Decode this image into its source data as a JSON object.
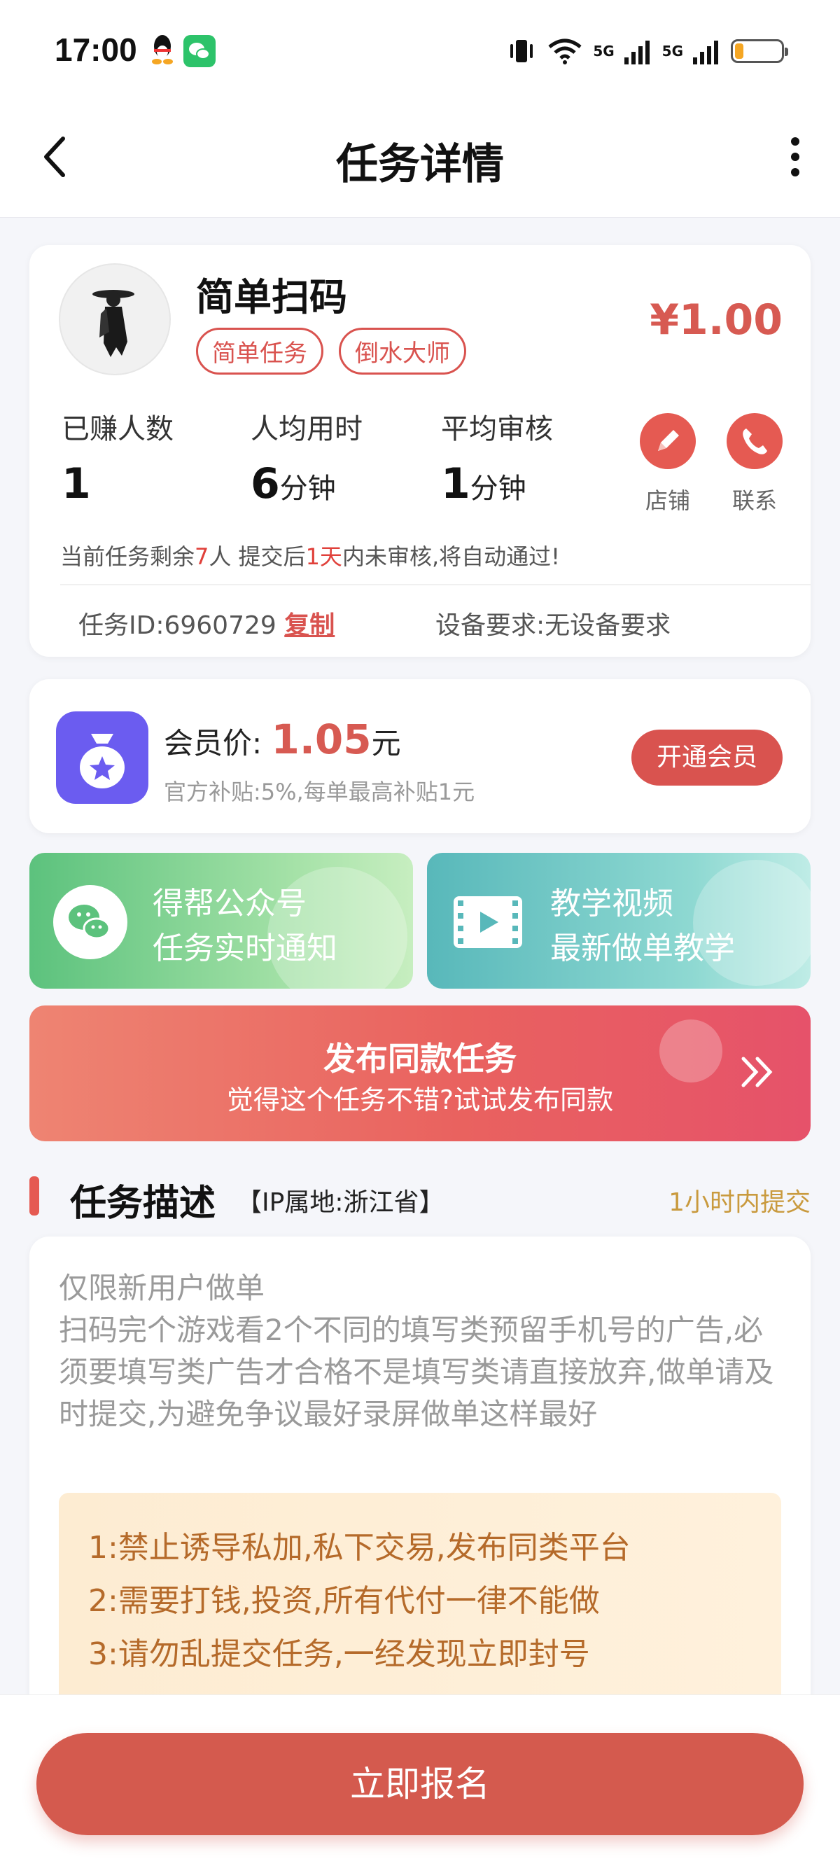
{
  "status_bar": {
    "time": "17:00",
    "network_1": "5G",
    "network_2": "5G",
    "battery_level": 0.18
  },
  "nav": {
    "title": "任务详情"
  },
  "task": {
    "title": "简单扫码",
    "tags": [
      "简单任务",
      "倒水大师"
    ],
    "price": "¥1.00",
    "stats": [
      {
        "label": "已赚人数",
        "value": "1",
        "unit": ""
      },
      {
        "label": "人均用时",
        "value": "6",
        "unit": "分钟"
      },
      {
        "label": "平均审核",
        "value": "1",
        "unit": "分钟"
      }
    ],
    "actions": [
      {
        "label": "店铺",
        "icon": "pencil-icon"
      },
      {
        "label": "联系",
        "icon": "phone-icon"
      }
    ],
    "remain_prefix": "当前任务剩余",
    "remain_count": "7",
    "remain_mid": "人  提交后",
    "remain_days": "1天",
    "remain_suffix": "内未审核,将自动通过!",
    "id_label": "任务ID:6960729",
    "copy_label": "复制",
    "device_label": "设备要求:无设备要求"
  },
  "vip": {
    "label": "会员价:",
    "price": "1.05",
    "unit": "元",
    "subtitle": "官方补贴:5%,每单最高补贴1元",
    "button": "开通会员"
  },
  "promos": {
    "wechat": {
      "line1": "得帮公众号",
      "line2": "任务实时通知"
    },
    "video": {
      "line1": "教学视频",
      "line2": "最新做单教学"
    }
  },
  "publish": {
    "title": "发布同款任务",
    "subtitle": "觉得这个任务不错?试试发布同款"
  },
  "section": {
    "title": "任务描述",
    "ip": "【IP属地:浙江省】",
    "time_limit": "1小时内提交"
  },
  "description": {
    "text": "仅限新用户做单\n扫码完个游戏看2个不同的填写类预留手机号的广告,必须要填写类广告才合格不是填写类请直接放弃,做单请及时提交,为避免争议最好录屏做单这样最好",
    "rules": [
      "1:禁止诱导私加,私下交易,发布同类平台",
      "2:需要打钱,投资,所有代付一律不能做",
      "3:请勿乱提交任务,一经发现立即封号"
    ]
  },
  "bottom": {
    "button": "立即报名"
  },
  "colors": {
    "accent": "#d9534f",
    "price": "#d75a52",
    "vip_icon": "#6b5cf0",
    "green": "#5cc27d",
    "teal": "#58b8ba"
  }
}
